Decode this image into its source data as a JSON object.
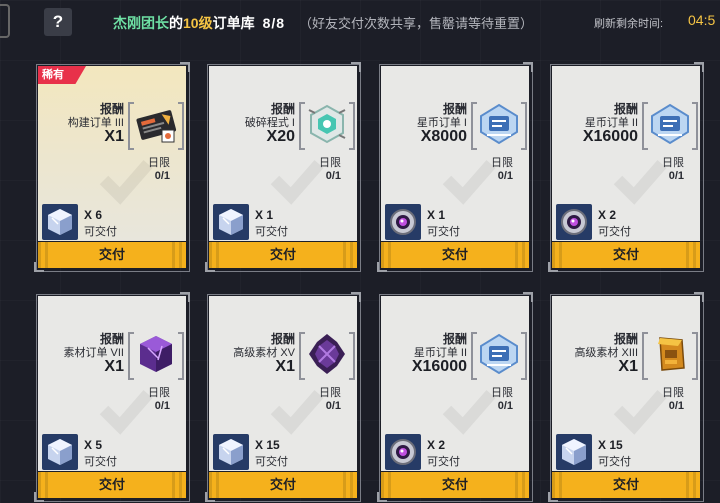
{
  "header": {
    "title_name": "杰刚团长",
    "title_of": "的",
    "title_level": "10级",
    "title_suffix": "订单库",
    "count": "8/8",
    "note": "（好友交付次数共享，售罄请等待重置）",
    "refresh_label": "刷新剩余时间:",
    "timer": "04:5"
  },
  "reward_label": "报酬",
  "limit_label": "日限",
  "deliver_label": "交付",
  "rare_label": "稀有",
  "cards": [
    {
      "rare": true,
      "reward_name": "构建订单 III",
      "reward_qty": "X1",
      "reward_icon": "order-card-icon",
      "limit": "0/1",
      "req_icon": "cube-crystal-icon",
      "req_qty": "X 6",
      "req_status": "可交付"
    },
    {
      "rare": false,
      "reward_name": "破碎程式 I",
      "reward_qty": "X20",
      "reward_icon": "hex-chip-icon",
      "limit": "0/1",
      "req_icon": "cube-crystal-icon",
      "req_qty": "X 1",
      "req_status": "可交付"
    },
    {
      "rare": false,
      "reward_name": "星币订单 I",
      "reward_qty": "X8000",
      "reward_icon": "star-coin-ticket-icon",
      "limit": "0/1",
      "req_icon": "purple-orb-icon",
      "req_qty": "X 1",
      "req_status": "可交付"
    },
    {
      "rare": false,
      "reward_name": "星币订单 II",
      "reward_qty": "X16000",
      "reward_icon": "star-coin-ticket-icon",
      "limit": "0/1",
      "req_icon": "purple-orb-icon",
      "req_qty": "X 2",
      "req_status": "可交付"
    },
    {
      "rare": false,
      "reward_name": "素材订单 VII",
      "reward_qty": "X1",
      "reward_icon": "purple-cube-icon",
      "limit": "0/1",
      "req_icon": "cube-crystal-icon",
      "req_qty": "X 5",
      "req_status": "可交付"
    },
    {
      "rare": false,
      "reward_name": "高级素材 XV",
      "reward_qty": "X1",
      "reward_icon": "dark-crystal-icon",
      "limit": "0/1",
      "req_icon": "cube-crystal-icon",
      "req_qty": "X 15",
      "req_status": "可交付"
    },
    {
      "rare": false,
      "reward_name": "星币订单 II",
      "reward_qty": "X16000",
      "reward_icon": "star-coin-ticket-icon",
      "limit": "0/1",
      "req_icon": "purple-orb-icon",
      "req_qty": "X 2",
      "req_status": "可交付"
    },
    {
      "rare": false,
      "reward_name": "高级素材 XIII",
      "reward_qty": "X1",
      "reward_icon": "gold-box-icon",
      "limit": "0/1",
      "req_icon": "cube-crystal-icon",
      "req_qty": "X 15",
      "req_status": "可交付"
    }
  ]
}
